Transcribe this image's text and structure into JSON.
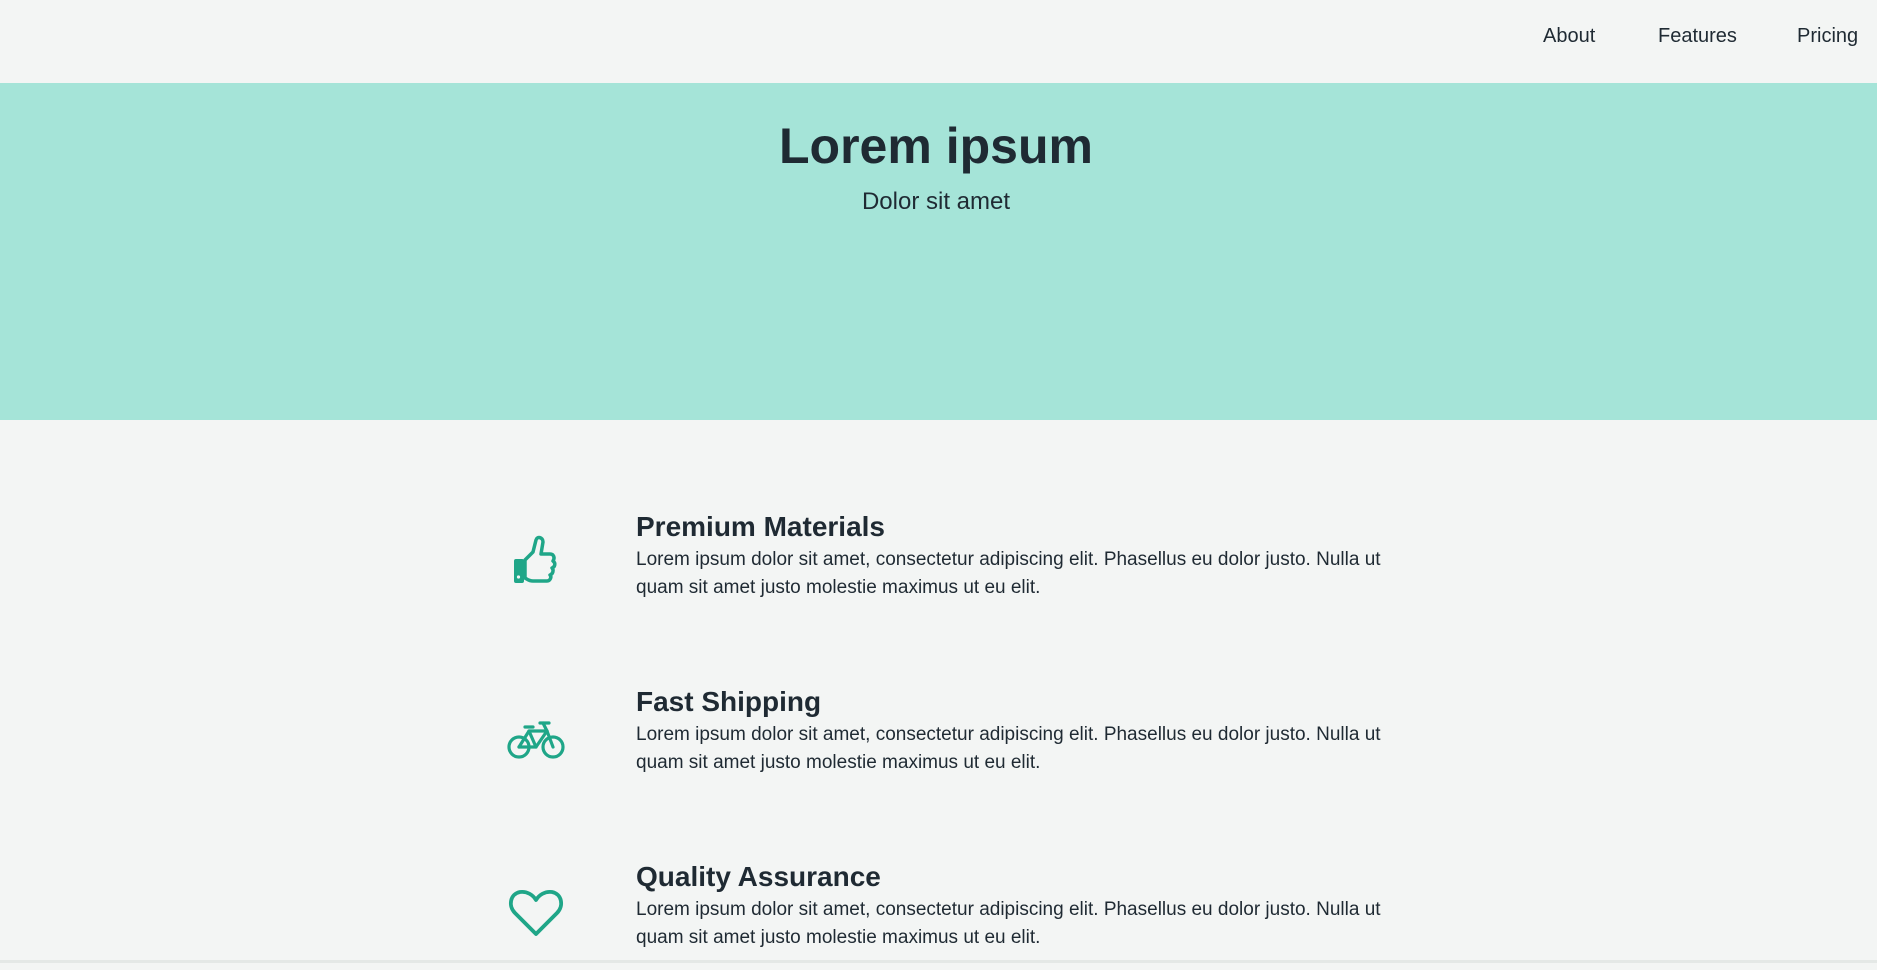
{
  "nav": {
    "items": [
      {
        "label": "About"
      },
      {
        "label": "Features"
      },
      {
        "label": "Pricing"
      }
    ]
  },
  "hero": {
    "title": "Lorem ipsum",
    "subtitle": "Dolor sit amet"
  },
  "features": [
    {
      "icon": "thumbs-up-icon",
      "title": "Premium Materials",
      "text": "Lorem ipsum dolor sit amet, consectetur adipiscing elit. Phasellus eu dolor justo. Nulla ut quam sit amet justo molestie maximus ut eu elit."
    },
    {
      "icon": "bicycle-icon",
      "title": "Fast Shipping",
      "text": "Lorem ipsum dolor sit amet, consectetur adipiscing elit. Phasellus eu dolor justo. Nulla ut quam sit amet justo molestie maximus ut eu elit."
    },
    {
      "icon": "heart-icon",
      "title": "Quality Assurance",
      "text": "Lorem ipsum dolor sit amet, consectetur adipiscing elit. Phasellus eu dolor justo. Nulla ut quam sit amet justo molestie maximus ut eu elit."
    }
  ],
  "colors": {
    "accent": "#1fa688",
    "hero_background": "#a5e4d8",
    "page_background": "#f3f5f4",
    "text": "#1f2a33"
  }
}
